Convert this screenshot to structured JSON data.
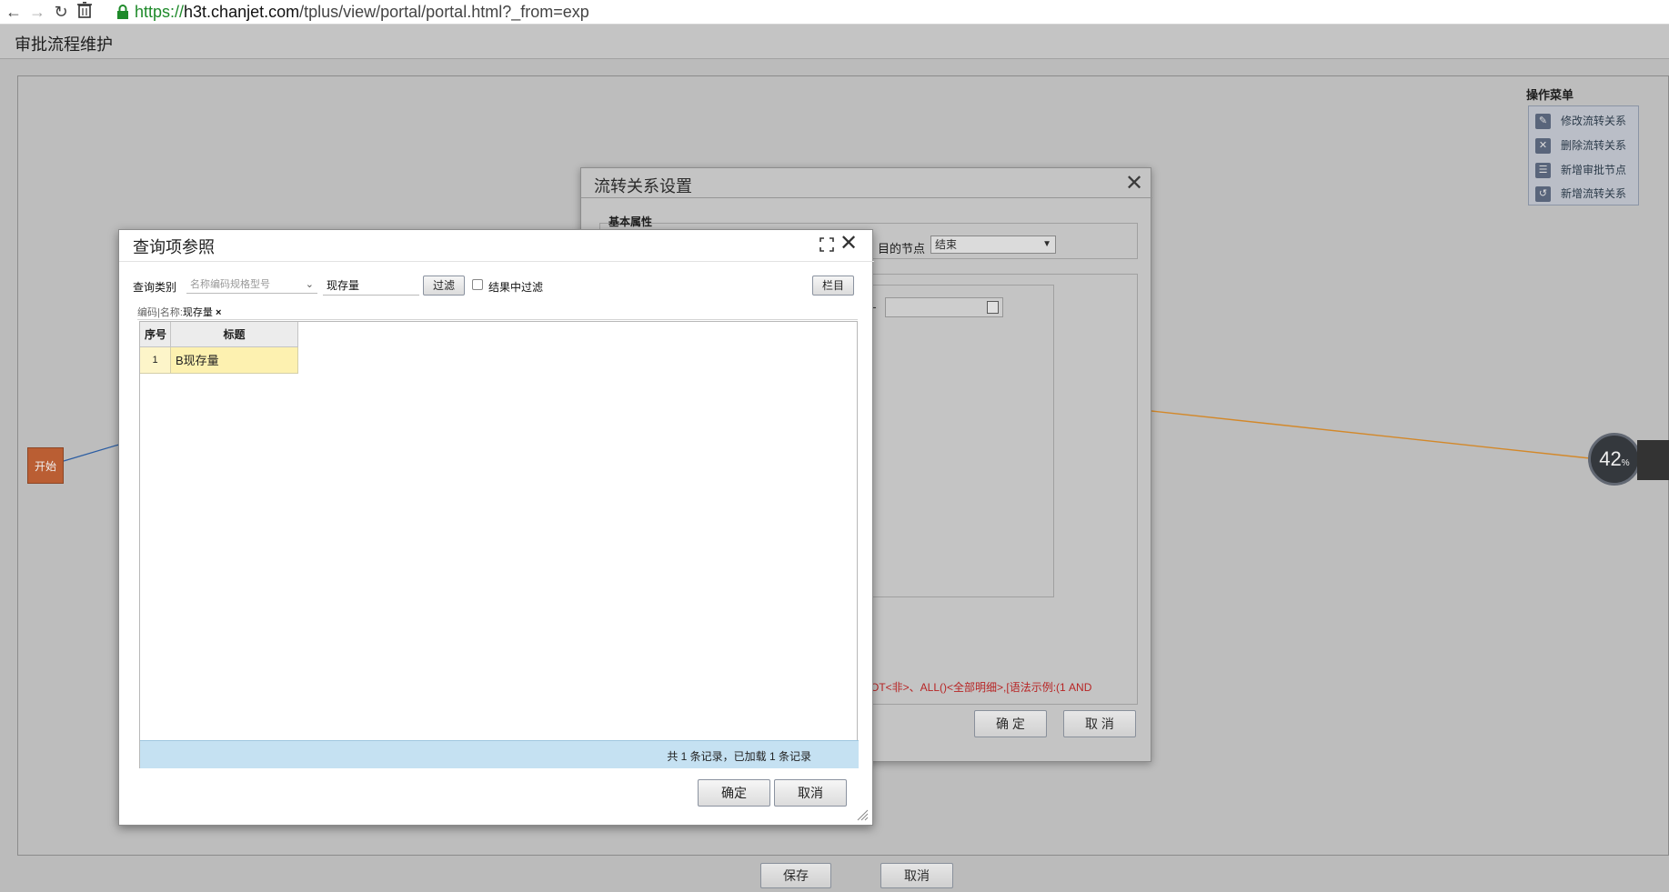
{
  "browser": {
    "url_scheme": "https://",
    "url_host": "h3t.chanjet.com",
    "url_path": "/tplus/view/portal/portal.html?_from=exp"
  },
  "page": {
    "title": "审批流程维护"
  },
  "canvas": {
    "start_node_label": "开始"
  },
  "op_menu": {
    "title": "操作菜单",
    "items": [
      {
        "label": "修改流转关系",
        "icon": "edit-icon"
      },
      {
        "label": "删除流转关系",
        "icon": "delete-icon"
      },
      {
        "label": "新增审批节点",
        "icon": "add-node-icon"
      },
      {
        "label": "新增流转关系",
        "icon": "add-relation-icon"
      }
    ]
  },
  "progress": {
    "value": "42",
    "unit": "%"
  },
  "bottom": {
    "save_label": "保存",
    "cancel_label": "取消"
  },
  "flow_dialog": {
    "title": "流转关系设置",
    "section_basic": "基本属性",
    "target_label": "目的节点",
    "target_value": "结束",
    "syntax_hint": "OT<非>、ALL()<全部明细>,[语法示例:(1 AND",
    "ok_label": "确 定",
    "cancel_label": "取 消"
  },
  "query_dialog": {
    "title": "查询项参照",
    "query_type_label": "查询类别",
    "query_type_placeholder": "名称编码规格型号",
    "keyword_value": "现存量",
    "filter_label": "过滤",
    "result_filter_label": "结果中过滤",
    "result_filter_checked": false,
    "columns_label": "栏目",
    "filter_tag_prefix": "编码|名称:",
    "filter_tag_value": "现存量",
    "filter_tag_remove": "×",
    "columns": [
      "序号",
      "标题"
    ],
    "rows": [
      {
        "no": "1",
        "title": "B现存量"
      }
    ],
    "record_summary": "共 1 条记录，已加载 1 条记录",
    "ok_label": "确定",
    "cancel_label": "取消"
  },
  "colors": {
    "start_node": "#c35a2a",
    "selected_row": "#fdf1b0",
    "footer_bar": "#c5e1f2",
    "hint_red": "#c01818",
    "flow_line_orange": "#e08a1e",
    "flow_line_blue": "#1f58a8"
  }
}
